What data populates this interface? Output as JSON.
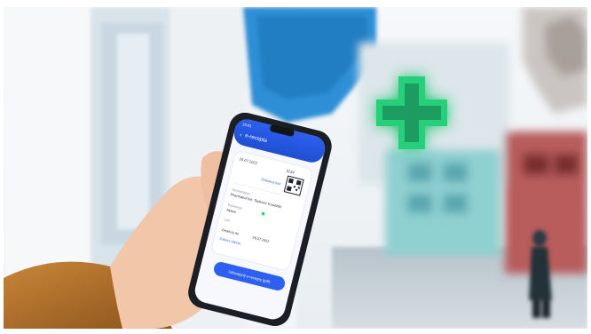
{
  "phone": {
    "status_time": "10:41",
    "app_title": "e-recepta",
    "prescription_date": "26.07.2022",
    "code": "5234",
    "barcode_link": "Zeskanuj kod",
    "doctor_label": "Wystawiający",
    "doctor_name": "Pharmakol lek. Tadeusz Kowalski",
    "dose_label": "Realizacja",
    "dose_value": "Aktive",
    "drug_label": "Leki",
    "valid_label": "Zrealizuj do",
    "valid_date": "26.07.2022",
    "more_link": "Zobacz więcej",
    "cta_label": "Udostępnij e-receptę (pdf)"
  },
  "scene": {
    "pharmacy_cross_color": "#28d07a",
    "sky_color": "#eef3f6",
    "wall_color": "#f2f3f5",
    "awning_color": "#2f8fd6",
    "sleeve_color": "#b8742e",
    "skin_color": "#f2c6a8",
    "phone_screen_color": "#ffffff",
    "phone_header_color": "#1f63e0"
  }
}
